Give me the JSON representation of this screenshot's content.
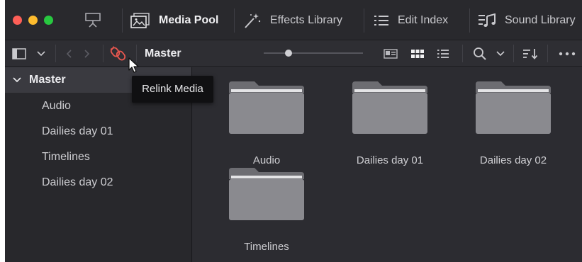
{
  "window": {
    "controls": [
      "close",
      "minimize",
      "zoom"
    ],
    "colors": {
      "close": "#fe5f57",
      "minimize": "#febc2e",
      "zoom": "#28c840"
    }
  },
  "tabs": [
    {
      "label": "Media Pool",
      "icon": "media-pool-icon",
      "active": true
    },
    {
      "label": "Effects Library",
      "icon": "effects-wand-icon",
      "active": false
    },
    {
      "label": "Edit Index",
      "icon": "list-index-icon",
      "active": false
    },
    {
      "label": "Sound Library",
      "icon": "sound-library-icon",
      "active": false
    }
  ],
  "toolbar": {
    "title": "Master",
    "zoom_level": 0.25,
    "icons": [
      "sidebar-toggle-icon",
      "chevron-down-icon",
      "back-arrow-icon",
      "forward-arrow-icon",
      "relink-media-icon",
      "metadata-view-icon",
      "thumbnail-view-icon",
      "list-view-icon",
      "search-icon",
      "chevron-down-icon",
      "sort-icon",
      "more-icon"
    ]
  },
  "sidebar": {
    "root": "Master",
    "items": [
      "Audio",
      "Dailies day 01",
      "Timelines",
      "Dailies day 02"
    ]
  },
  "bins": [
    "Audio",
    "Dailies day 01",
    "Dailies day 02",
    "Timelines"
  ],
  "tooltip": {
    "text": "Relink Media"
  },
  "colors": {
    "accent_relink": "#e8574f",
    "background": "#2b2b30",
    "folder": "#8a8a8f"
  }
}
